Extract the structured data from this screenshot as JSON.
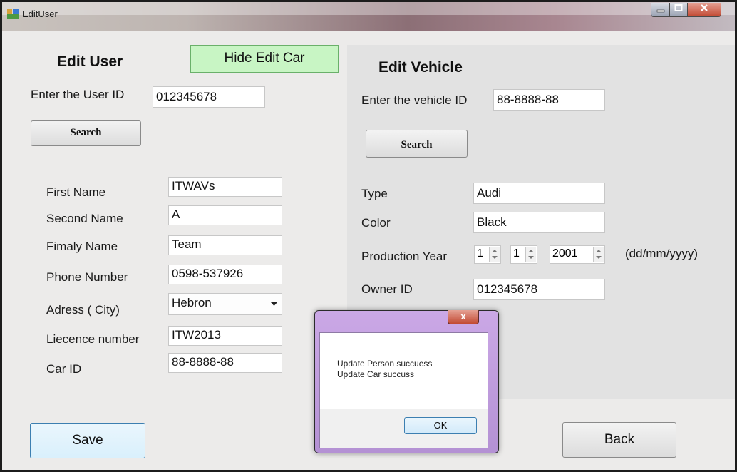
{
  "window": {
    "title": "EditUser"
  },
  "user": {
    "heading": "Edit User",
    "toggle_button": "Hide Edit Car",
    "id_label": "Enter the User ID",
    "id_value": "012345678",
    "search_button": "Search",
    "fields": [
      {
        "label": "First Name",
        "value": "ITWAVs"
      },
      {
        "label": "Second Name",
        "value": "A"
      },
      {
        "label": "Fimaly Name",
        "value": "Team"
      },
      {
        "label": "Phone Number",
        "value": "0598-537926"
      },
      {
        "label": "Adress ( City)",
        "value": "Hebron"
      },
      {
        "label": "Liecence number",
        "value": "ITW2013"
      },
      {
        "label": "Car ID",
        "value": "88-8888-88"
      }
    ],
    "save_button": "Save"
  },
  "vehicle": {
    "heading": "Edit Vehicle",
    "id_label": "Enter the vehicle ID",
    "id_value": "88-8888-88",
    "search_button": "Search",
    "type_label": "Type",
    "type_value": "Audi",
    "color_label": "Color",
    "color_value": "Black",
    "year_label": "Production Year",
    "day": "1",
    "month": "1",
    "year": "2001",
    "date_hint": "(dd/mm/yyyy)",
    "owner_label": "Owner ID",
    "owner_value": "012345678",
    "back_button": "Back"
  },
  "dialog": {
    "close_glyph": "x",
    "line1": "Update Person succuess",
    "line2": "Update Car succuss",
    "ok_button": "OK"
  }
}
